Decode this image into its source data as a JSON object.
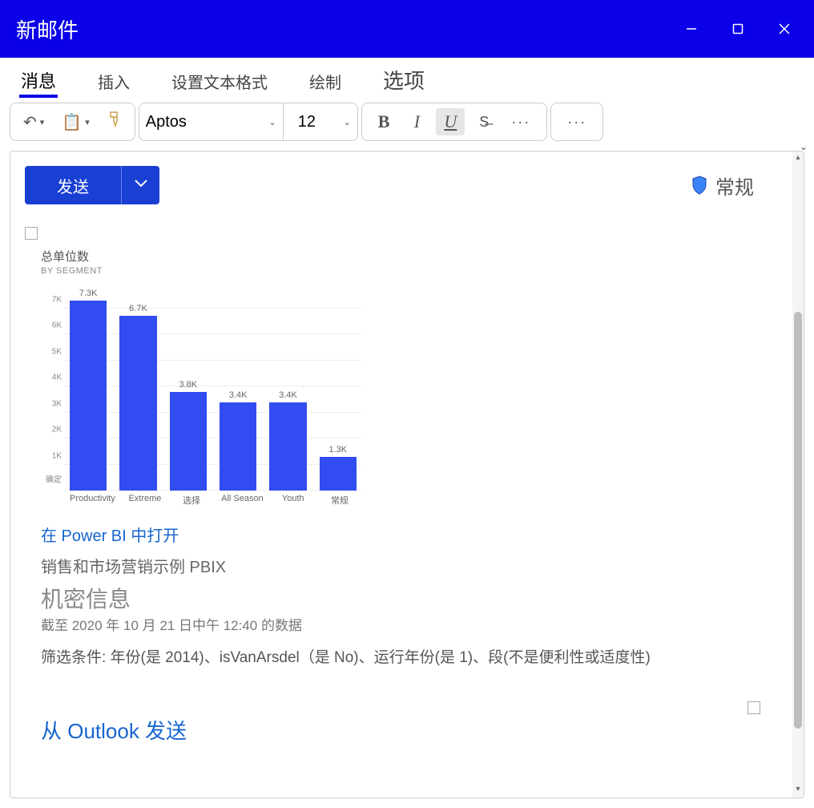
{
  "window": {
    "title": "新邮件"
  },
  "ribbon": {
    "tabs": {
      "message": "消息",
      "insert": "插入",
      "format_text": "设置文本格式",
      "draw": "绘制",
      "options": "选项"
    }
  },
  "toolbar": {
    "font_name": "Aptos",
    "font_size": "12",
    "bold": "B",
    "italic": "I",
    "underline": "U",
    "strike": "ꜱ",
    "more1": "···",
    "more2": "···"
  },
  "send": {
    "label": "发送"
  },
  "sensitivity": {
    "label": "常规"
  },
  "body": {
    "open_in_powerbi": "在 Power BI 中打开",
    "pbix": "销售和市场营销示例 PBIX",
    "confidential": "机密信息",
    "data_as_of": "截至 2020 年 10 月 21 日中午 12:40 的数据",
    "filters": "筛选条件: 年份(是 2014)、isVanArsdel（是 No)、运行年份(是 1)、段(不是便利性或适度性)",
    "from_outlook": "从 Outlook 发送"
  },
  "chart_data": {
    "type": "bar",
    "title": "总单位数",
    "subtitle": "BY SEGMENT",
    "categories": [
      "Productivity",
      "Extreme",
      "选择",
      "All Season",
      "Youth",
      "常规"
    ],
    "values": [
      7300,
      6700,
      3800,
      3400,
      3400,
      1300
    ],
    "value_labels": [
      "7.3K",
      "6.7K",
      "3.8K",
      "3.4K",
      "3.4K",
      "1.3K"
    ],
    "y_ticks": [
      0,
      1000,
      2000,
      3000,
      4000,
      5000,
      6000,
      7000
    ],
    "y_tick_labels": [
      "确定",
      "1K",
      "2K",
      "3K",
      "4K",
      "5K",
      "6K",
      "7K"
    ],
    "ylim": [
      0,
      8000
    ]
  }
}
